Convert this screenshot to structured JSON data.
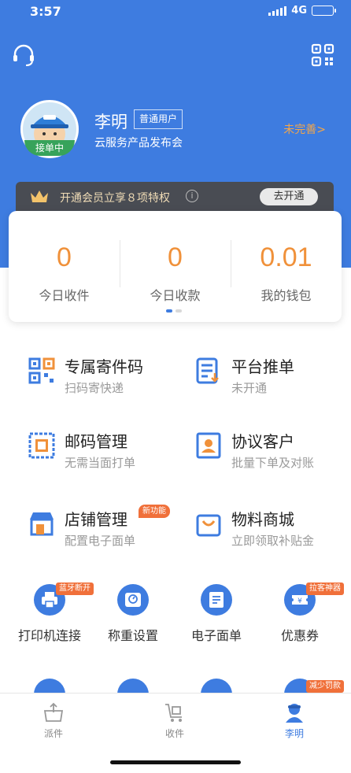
{
  "status_bar": {
    "time": "3:57",
    "network": "4G"
  },
  "profile": {
    "name": "李明",
    "badge": "普通用户",
    "subtitle": "云服务产品发布会",
    "avatar_status": "接单中",
    "link": "未完善>"
  },
  "vip": {
    "text": "开通会员立享８项特权",
    "info_icon": "i",
    "button": "去开通"
  },
  "stats": [
    {
      "value": "0",
      "label": "今日收件"
    },
    {
      "value": "0",
      "label": "今日收款"
    },
    {
      "value": "0.01",
      "label": "我的钱包"
    }
  ],
  "services": [
    {
      "title": "专属寄件码",
      "subtitle": "扫码寄快递",
      "icon": "qr-code-icon"
    },
    {
      "title": "平台推单",
      "subtitle": "未开通",
      "icon": "order-list-icon"
    },
    {
      "title": "邮码管理",
      "subtitle": "无需当面打单",
      "icon": "stamp-icon"
    },
    {
      "title": "协议客户",
      "subtitle": "批量下单及对账",
      "icon": "contact-card-icon"
    },
    {
      "title": "店铺管理",
      "subtitle": "配置电子面单",
      "icon": "store-icon",
      "tag": "新功能"
    },
    {
      "title": "物料商城",
      "subtitle": "立即领取补贴金",
      "icon": "shopping-bag-icon"
    }
  ],
  "tools": [
    {
      "label": "打印机连接",
      "tag": "蓝牙断开",
      "icon": "printer-icon"
    },
    {
      "label": "称重设置",
      "icon": "scale-icon"
    },
    {
      "label": "电子面单",
      "icon": "waybill-icon"
    },
    {
      "label": "优惠券",
      "tag": "拉客神器",
      "icon": "coupon-icon"
    }
  ],
  "tools_row2_tag": "减少罚款",
  "tabs": [
    {
      "label": "派件",
      "icon": "delivery-box-icon"
    },
    {
      "label": "收件",
      "icon": "cart-icon"
    },
    {
      "label": "李明",
      "icon": "user-icon",
      "active": true
    }
  ],
  "colors": {
    "primary": "#3e7ce0",
    "accent": "#f0913a",
    "tag": "#f0703a",
    "vip_bg": "#494c53"
  }
}
